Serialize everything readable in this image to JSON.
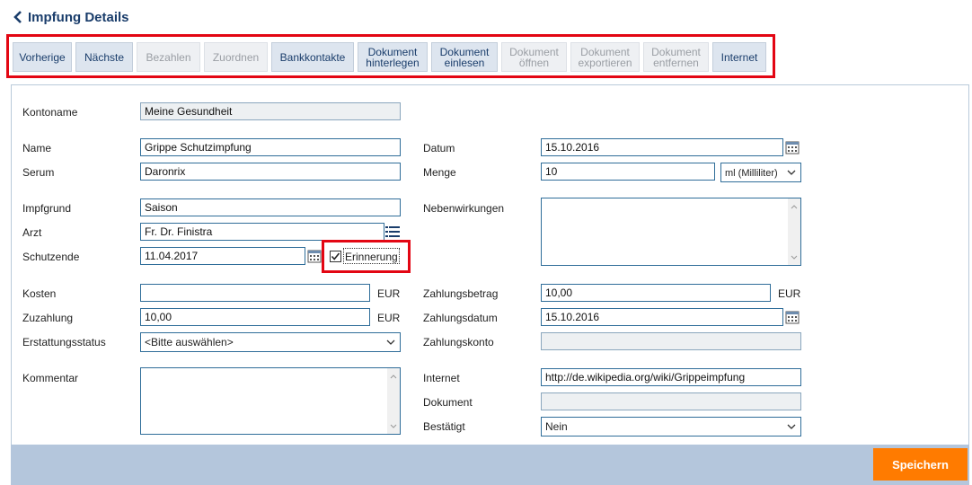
{
  "header": {
    "title": "Impfung  Details"
  },
  "toolbar": [
    {
      "label": "Vorherige",
      "enabled": true
    },
    {
      "label": "Nächste",
      "enabled": true
    },
    {
      "label": "Bezahlen",
      "enabled": false
    },
    {
      "label": "Zuordnen",
      "enabled": false
    },
    {
      "label": "Bankkontakte",
      "enabled": true
    },
    {
      "label": "Dokument\nhinterlegen",
      "enabled": true
    },
    {
      "label": "Dokument\neinlesen",
      "enabled": true
    },
    {
      "label": "Dokument\nöffnen",
      "enabled": false
    },
    {
      "label": "Dokument\nexportieren",
      "enabled": false
    },
    {
      "label": "Dokument\nentfernen",
      "enabled": false
    },
    {
      "label": "Internet",
      "enabled": true
    }
  ],
  "form": {
    "kontoname": {
      "label": "Kontoname",
      "value": "Meine Gesundheit"
    },
    "name": {
      "label": "Name",
      "value": "Grippe Schutzimpfung"
    },
    "serum": {
      "label": "Serum",
      "value": "Daronrix"
    },
    "impfgrund": {
      "label": "Impfgrund",
      "value": "Saison"
    },
    "arzt": {
      "label": "Arzt",
      "value": "Fr. Dr. Finistra"
    },
    "schutzende": {
      "label": "Schutzende",
      "value": "11.04.2017"
    },
    "erinnerung": {
      "label": "Erinnerung",
      "checked": true
    },
    "kosten": {
      "label": "Kosten",
      "value": "",
      "unit": "EUR"
    },
    "zuzahlung": {
      "label": "Zuzahlung",
      "value": "10,00",
      "unit": "EUR"
    },
    "erstattungsstatus": {
      "label": "Erstattungsstatus",
      "value": "<Bitte auswählen>"
    },
    "kommentar": {
      "label": "Kommentar",
      "value": ""
    },
    "datum": {
      "label": "Datum",
      "value": "15.10.2016"
    },
    "menge": {
      "label": "Menge",
      "value": "10",
      "unit_select": "ml (Milliliter)"
    },
    "nebenwirkungen": {
      "label": "Nebenwirkungen",
      "value": ""
    },
    "zahlungsbetrag": {
      "label": "Zahlungsbetrag",
      "value": "10,00",
      "unit": "EUR"
    },
    "zahlungsdatum": {
      "label": "Zahlungsdatum",
      "value": "15.10.2016"
    },
    "zahlungskonto": {
      "label": "Zahlungskonto",
      "value": ""
    },
    "internet": {
      "label": "Internet",
      "value": "http://de.wikipedia.org/wiki/Grippeimpfung"
    },
    "dokument": {
      "label": "Dokument",
      "value": ""
    },
    "bestaetigt": {
      "label": "Bestätigt",
      "value": "Nein"
    }
  },
  "footer": {
    "save_label": "Speichern"
  },
  "colors": {
    "highlight": "#e30613",
    "primary_button": "#ff7b00",
    "footer_bar": "#b4c6dc",
    "title": "#1a3d6b"
  }
}
